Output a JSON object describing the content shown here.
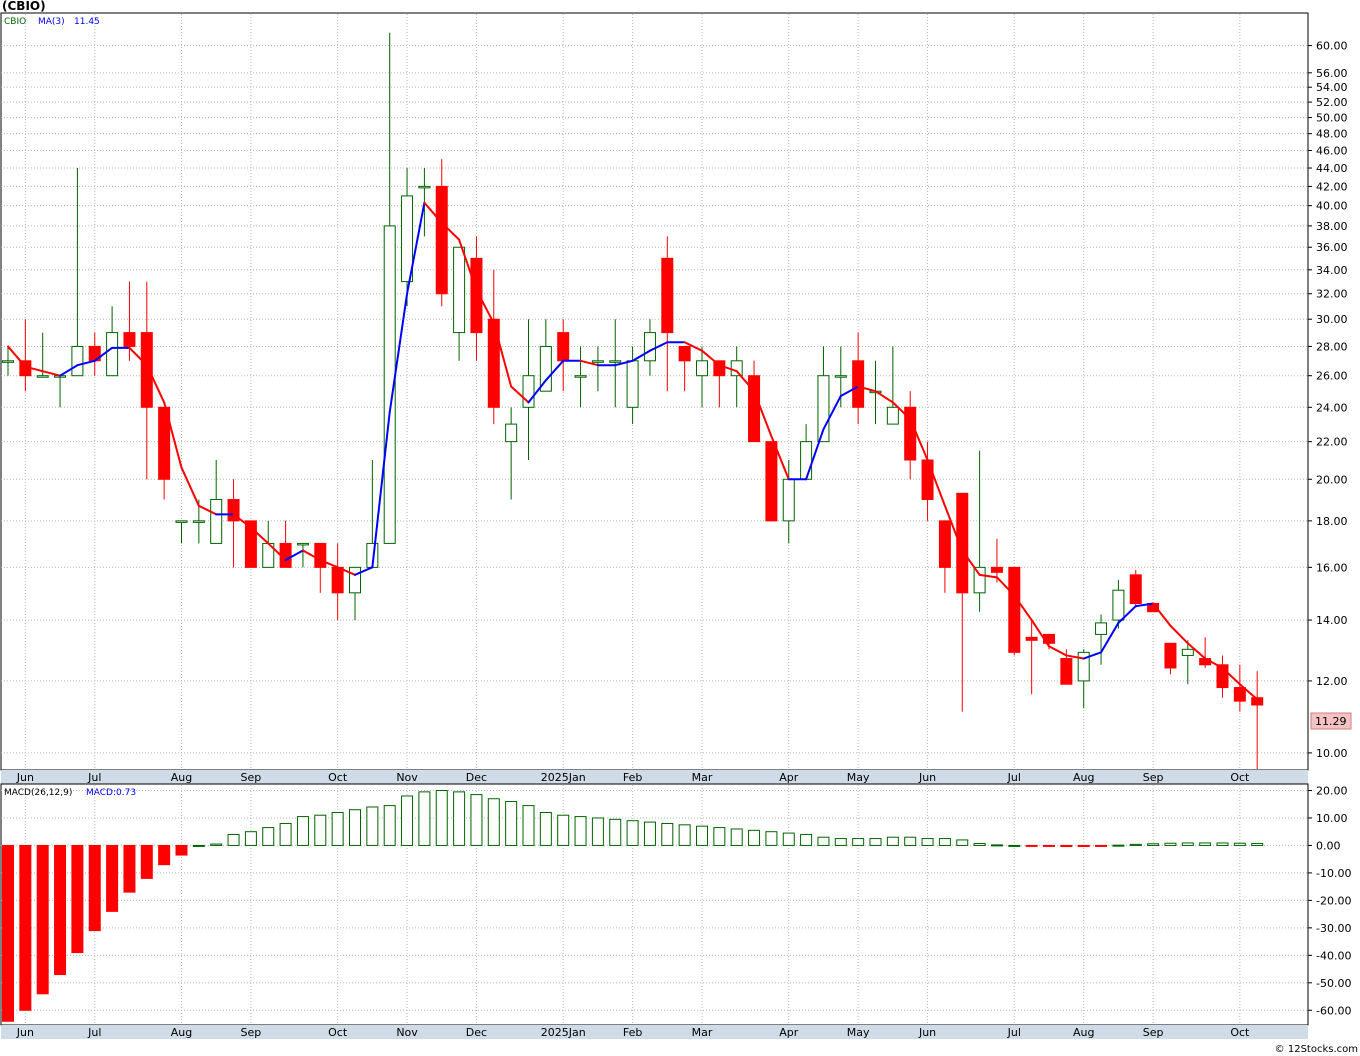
{
  "header": {
    "title": "(CBIO)"
  },
  "legend": {
    "symbol": "CBIO",
    "ma_label": "MA(3)",
    "ma_value": "11.45",
    "macd_params": "MACD(26,12,9)",
    "macd_value": "MACD:0.73"
  },
  "last_price": "11.29",
  "watermark": "© 12Stocks.com",
  "colors": {
    "up": "#006400",
    "down": "#ff0000",
    "ma_up": "#0000ff",
    "ma_down": "#ff0000",
    "price_tag_bg": "#f4c2c2",
    "grid": "#b8b8b8",
    "axis_band": "#cfdbe6"
  },
  "chart_data": [
    {
      "type": "candlestick",
      "scale": "log",
      "ylim": [
        9.6,
        65
      ],
      "y_ticks": [
        10,
        12,
        14,
        16,
        18,
        20,
        22,
        24,
        26,
        28,
        30,
        32,
        34,
        36,
        38,
        40,
        42,
        44,
        46,
        48,
        50,
        52,
        54,
        56,
        60
      ],
      "y_tick_labels": [
        "10.00",
        "12.00",
        "14.00",
        "16.00",
        "18.00",
        "20.00",
        "22.00",
        "24.00",
        "26.00",
        "28.00",
        "30.00",
        "32.00",
        "34.00",
        "36.00",
        "38.00",
        "40.00",
        "42.00",
        "44.00",
        "46.00",
        "48.00",
        "50.00",
        "52.00",
        "54.00",
        "56.00",
        "60.00"
      ],
      "x_labels": [
        "Jun",
        "Jul",
        "Aug",
        "Sep",
        "Oct",
        "Nov",
        "Dec",
        "2025Jan",
        "Feb",
        "Mar",
        "Apr",
        "May",
        "Jun",
        "Jul",
        "Aug",
        "Sep",
        "Oct"
      ],
      "x_label_index": [
        1,
        5,
        10,
        14,
        19,
        23,
        27,
        32,
        36,
        40,
        45,
        49,
        53,
        58,
        62,
        66,
        71
      ],
      "candles": [
        {
          "o": 27,
          "h": 28,
          "l": 26,
          "c": 27
        },
        {
          "o": 27,
          "h": 30,
          "l": 25,
          "c": 26
        },
        {
          "o": 26,
          "h": 29,
          "l": 26,
          "c": 26
        },
        {
          "o": 26,
          "h": 26,
          "l": 24,
          "c": 26
        },
        {
          "o": 26,
          "h": 44,
          "l": 26,
          "c": 28
        },
        {
          "o": 28,
          "h": 29,
          "l": 26,
          "c": 27
        },
        {
          "o": 26,
          "h": 31,
          "l": 26,
          "c": 29
        },
        {
          "o": 29,
          "h": 33,
          "l": 27,
          "c": 28
        },
        {
          "o": 29,
          "h": 33,
          "l": 20,
          "c": 24
        },
        {
          "o": 24,
          "h": 24,
          "l": 19,
          "c": 20
        },
        {
          "o": 18,
          "h": 18,
          "l": 17,
          "c": 18
        },
        {
          "o": 18,
          "h": 19,
          "l": 17,
          "c": 18
        },
        {
          "o": 17,
          "h": 21,
          "l": 17,
          "c": 19
        },
        {
          "o": 19,
          "h": 20,
          "l": 16,
          "c": 18
        },
        {
          "o": 18,
          "h": 18,
          "l": 16,
          "c": 16
        },
        {
          "o": 16,
          "h": 18,
          "l": 16,
          "c": 17
        },
        {
          "o": 17,
          "h": 18,
          "l": 16,
          "c": 16
        },
        {
          "o": 17,
          "h": 17,
          "l": 16,
          "c": 17
        },
        {
          "o": 17,
          "h": 17,
          "l": 15,
          "c": 16
        },
        {
          "o": 16,
          "h": 17,
          "l": 14,
          "c": 15
        },
        {
          "o": 15,
          "h": 16,
          "l": 14,
          "c": 16
        },
        {
          "o": 16,
          "h": 21,
          "l": 16,
          "c": 17
        },
        {
          "o": 17,
          "h": 62,
          "l": 17,
          "c": 38
        },
        {
          "o": 33,
          "h": 44,
          "l": 31,
          "c": 41
        },
        {
          "o": 42,
          "h": 44,
          "l": 37,
          "c": 42
        },
        {
          "o": 42,
          "h": 45,
          "l": 31,
          "c": 32
        },
        {
          "o": 29,
          "h": 36,
          "l": 27,
          "c": 36
        },
        {
          "o": 35,
          "h": 37,
          "l": 27,
          "c": 29
        },
        {
          "o": 30,
          "h": 34,
          "l": 23,
          "c": 24
        },
        {
          "o": 22,
          "h": 24,
          "l": 19,
          "c": 23
        },
        {
          "o": 24,
          "h": 30,
          "l": 21,
          "c": 26
        },
        {
          "o": 25,
          "h": 30,
          "l": 25,
          "c": 28
        },
        {
          "o": 29,
          "h": 30,
          "l": 25,
          "c": 27
        },
        {
          "o": 26,
          "h": 28,
          "l": 24,
          "c": 26
        },
        {
          "o": 27,
          "h": 28,
          "l": 25,
          "c": 27
        },
        {
          "o": 27,
          "h": 30,
          "l": 24,
          "c": 27
        },
        {
          "o": 24,
          "h": 28,
          "l": 23,
          "c": 27
        },
        {
          "o": 27,
          "h": 30,
          "l": 26,
          "c": 29
        },
        {
          "o": 35,
          "h": 37,
          "l": 25,
          "c": 29
        },
        {
          "o": 28,
          "h": 28,
          "l": 25,
          "c": 27
        },
        {
          "o": 26,
          "h": 28,
          "l": 24,
          "c": 27
        },
        {
          "o": 27,
          "h": 27,
          "l": 24,
          "c": 26
        },
        {
          "o": 26,
          "h": 28,
          "l": 24,
          "c": 27
        },
        {
          "o": 26,
          "h": 27,
          "l": 22,
          "c": 22
        },
        {
          "o": 22,
          "h": 22,
          "l": 18,
          "c": 18
        },
        {
          "o": 18,
          "h": 21,
          "l": 17,
          "c": 20
        },
        {
          "o": 20,
          "h": 23,
          "l": 20,
          "c": 22
        },
        {
          "o": 22,
          "h": 28,
          "l": 22,
          "c": 26
        },
        {
          "o": 26,
          "h": 28,
          "l": 24,
          "c": 26
        },
        {
          "o": 27,
          "h": 29,
          "l": 23,
          "c": 24
        },
        {
          "o": 25,
          "h": 27,
          "l": 23,
          "c": 25
        },
        {
          "o": 23,
          "h": 28,
          "l": 23,
          "c": 24
        },
        {
          "o": 24,
          "h": 25,
          "l": 20,
          "c": 21
        },
        {
          "o": 21,
          "h": 22,
          "l": 18,
          "c": 19
        },
        {
          "o": 18,
          "h": 18,
          "l": 15,
          "c": 16
        },
        {
          "o": 19.3,
          "h": 19.3,
          "l": 11.1,
          "c": 15
        },
        {
          "o": 15,
          "h": 21.5,
          "l": 14.3,
          "c": 16
        },
        {
          "o": 16,
          "h": 17.2,
          "l": 15.4,
          "c": 15.8
        },
        {
          "o": 16,
          "h": 16,
          "l": 12.8,
          "c": 12.9
        },
        {
          "o": 13.4,
          "h": 14,
          "l": 11.6,
          "c": 13.3
        },
        {
          "o": 13.5,
          "h": 13.5,
          "l": 13,
          "c": 13.2
        },
        {
          "o": 12.7,
          "h": 13,
          "l": 11.9,
          "c": 11.9
        },
        {
          "o": 12,
          "h": 13,
          "l": 11.2,
          "c": 12.9
        },
        {
          "o": 13.5,
          "h": 14.2,
          "l": 12.5,
          "c": 13.9
        },
        {
          "o": 14,
          "h": 15.5,
          "l": 13.7,
          "c": 15.1
        },
        {
          "o": 15.7,
          "h": 15.9,
          "l": 14.5,
          "c": 14.6
        },
        {
          "o": 14.6,
          "h": 14.6,
          "l": 14.3,
          "c": 14.3
        },
        {
          "o": 13.2,
          "h": 13.2,
          "l": 12.2,
          "c": 12.4
        },
        {
          "o": 12.8,
          "h": 13.3,
          "l": 11.9,
          "c": 13.0
        },
        {
          "o": 12.7,
          "h": 13.4,
          "l": 12.4,
          "c": 12.5
        },
        {
          "o": 12.5,
          "h": 12.8,
          "l": 11.5,
          "c": 11.8
        },
        {
          "o": 11.8,
          "h": 12.5,
          "l": 11.1,
          "c": 11.4
        },
        {
          "o": 11.5,
          "h": 12.3,
          "l": 9.6,
          "c": 11.29
        }
      ],
      "ma": [
        28,
        26.6,
        26.3,
        26,
        26.7,
        27,
        27.9,
        27.9,
        26.7,
        24.3,
        20.6,
        18.7,
        18.3,
        18.3,
        17.7,
        17,
        16.3,
        16.7,
        16.3,
        16,
        15.7,
        16,
        23.7,
        32,
        40.3,
        38.3,
        36.7,
        32.3,
        29.7,
        25.3,
        24.3,
        25.7,
        27,
        27,
        26.7,
        26.7,
        27,
        27.7,
        28.3,
        28.3,
        27.7,
        26.7,
        26.3,
        25,
        22.3,
        20,
        20,
        22.7,
        24.7,
        25.3,
        25,
        24.3,
        23.3,
        21,
        18.7,
        16.7,
        15.7,
        15.6,
        14.9,
        14.0,
        13.1,
        12.8,
        12.7,
        12.9,
        13.9,
        14.5,
        14.6,
        13.8,
        13.2,
        12.7,
        12.4,
        11.9,
        11.45
      ],
      "series": [
        {
          "name": "MA(3)"
        }
      ]
    },
    {
      "type": "bar",
      "ylim": [
        -65,
        22
      ],
      "y_ticks": [
        -60,
        -50,
        -40,
        -30,
        -20,
        -10,
        0,
        10,
        20
      ],
      "y_tick_labels": [
        "-60.00",
        "-50.00",
        "-40.00",
        "-30.00",
        "-20.00",
        "-10.00",
        "0.00",
        "10.00",
        "20.00"
      ],
      "x_labels": [
        "Jun",
        "Jul",
        "Aug",
        "Sep",
        "Oct",
        "Nov",
        "Dec",
        "2025Jan",
        "Feb",
        "Mar",
        "Apr",
        "May",
        "Jun",
        "Jul",
        "Aug",
        "Sep",
        "Oct"
      ],
      "values": [
        -64,
        -60,
        -54,
        -47,
        -39,
        -31,
        -24,
        -17,
        -12,
        -7,
        -3.5,
        0,
        0.5,
        4,
        5,
        6.5,
        8,
        10.5,
        11,
        12,
        13,
        14,
        14.5,
        18,
        19.5,
        20,
        19.5,
        18.5,
        17,
        16,
        14.5,
        12,
        11,
        10.5,
        10,
        9.5,
        9,
        8.5,
        8,
        7.5,
        7,
        6.5,
        6,
        5.5,
        5,
        4.5,
        4,
        3,
        2.5,
        2.5,
        2.5,
        3,
        3,
        2.5,
        2.5,
        2,
        0.7,
        0.2,
        0,
        -0.2,
        -0.3,
        -0.4,
        -0.4,
        -0.3,
        0.1,
        0.4,
        0.6,
        0.8,
        0.9,
        0.9,
        0.9,
        0.8,
        0.73
      ]
    }
  ]
}
